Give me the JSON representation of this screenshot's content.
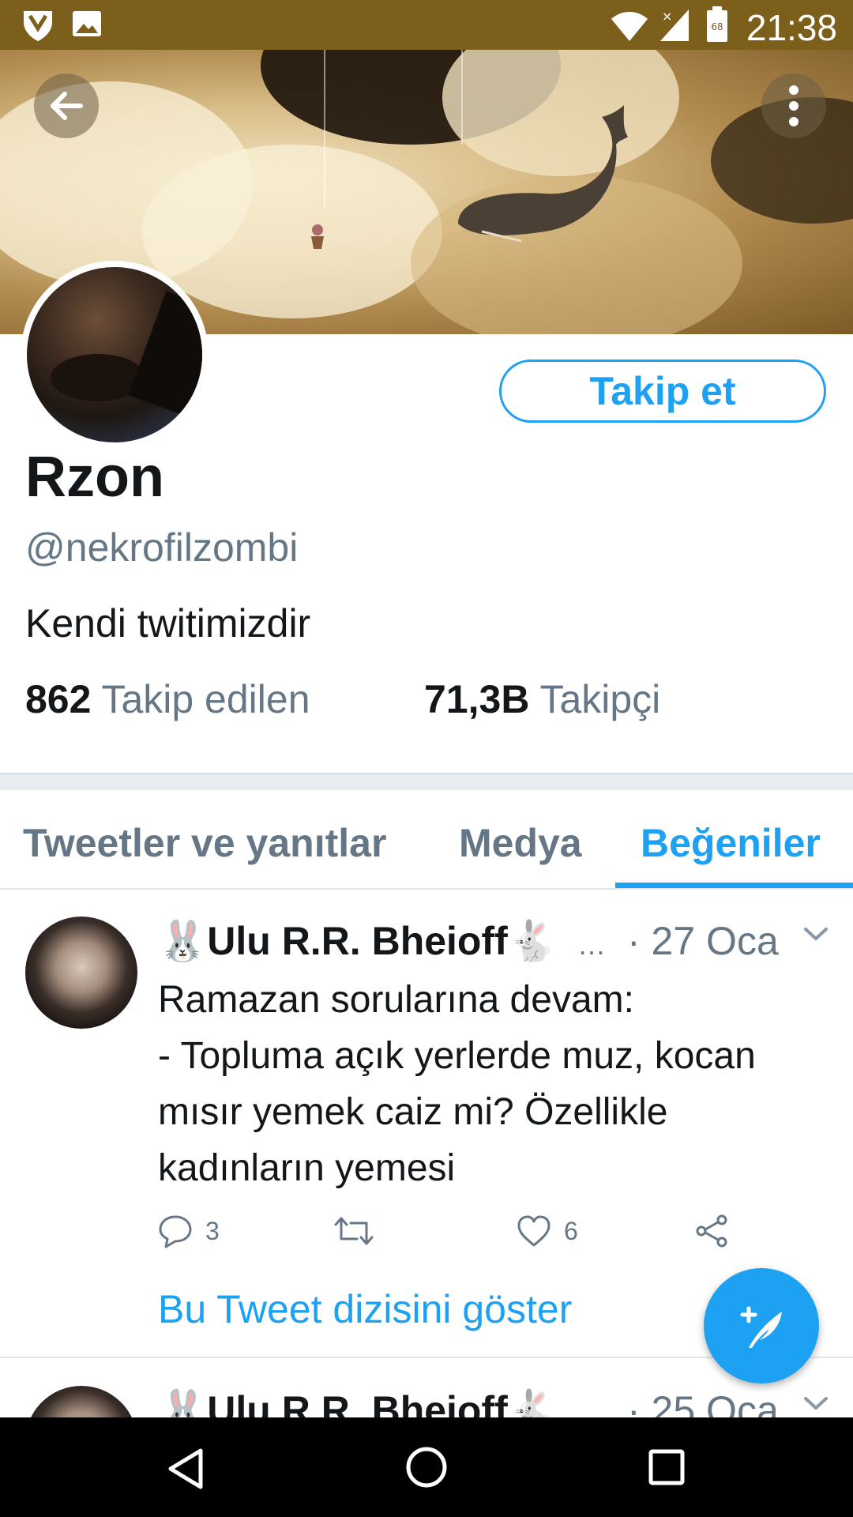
{
  "status_bar": {
    "time": "21:38",
    "battery_level": "68",
    "icons": [
      "shield-icon",
      "image-icon",
      "wifi-icon",
      "signal-icon",
      "battery-icon"
    ]
  },
  "header": {
    "back_icon": "arrow-left-icon",
    "menu_icon": "more-vertical-icon"
  },
  "profile": {
    "name": "Rzon",
    "handle": "@nekrofilzombi",
    "bio": "Kendi twitimizdir",
    "follow_label": "Takip et",
    "following_count": "862",
    "following_label": "Takip edilen",
    "followers_count": "71,3B",
    "followers_label": "Takipçi"
  },
  "tabs": [
    {
      "label": "Tweetler ve yanıtlar",
      "active": false
    },
    {
      "label": "Medya",
      "active": false
    },
    {
      "label": "Beğeniler",
      "active": true
    }
  ],
  "tweets": [
    {
      "author": "🐰Ulu R.R. Bheioff🐇",
      "ellipsis": "…",
      "date": "· 27 Oca",
      "lines": [
        "Ramazan sorularına devam:",
        "- Topluma açık yerlerde muz, kocan",
        "mısır yemek caiz mi? Özellikle",
        "kadınların yemesi"
      ],
      "replies": "3",
      "likes": "6",
      "thread_link": "Bu Tweet dizisini göster"
    },
    {
      "author": "🐰Ulu R.R. Bheioff🐇",
      "date": "· 25 Oca"
    }
  ],
  "colors": {
    "accent": "#1da1f2",
    "status_bar": "#7d5f1c",
    "secondary_text": "#657786"
  }
}
